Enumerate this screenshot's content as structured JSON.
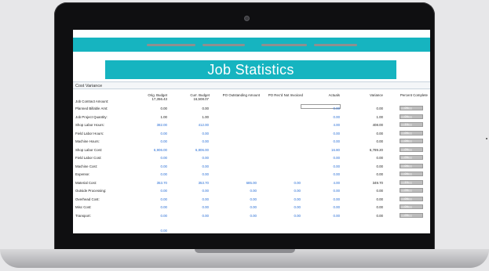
{
  "page": {
    "title": "Job Statistics",
    "section": "Cost Variance"
  },
  "columns": [
    "Orig. Budget",
    "Curr. Budget",
    "PO Outstanding Amount",
    "PO Rec'd Not Invoiced",
    "Actuals",
    "Variance",
    "Percent Complete"
  ],
  "header_values": {
    "label": "Job Contract Amount:",
    "orig": "17,356.43",
    "curr": "16,508.07"
  },
  "rows": [
    {
      "label": "Planned Billable Amt:",
      "orig": "0.00",
      "curr": "0.00",
      "actuals": "0.00",
      "variance": "0.00",
      "pct": "0%",
      "blue": false
    },
    {
      "label": "Job Project Quantity:",
      "orig": "1.00",
      "curr": "1.00",
      "actuals": "0.00",
      "variance": "1.00",
      "pct": "0%",
      "blue": false
    },
    {
      "label": "Shop Labor Hours:",
      "orig": "382.00",
      "curr": "412.00",
      "actuals": "4.00",
      "variance": "408.00",
      "pct": "1%",
      "blue": true
    },
    {
      "label": "Field Labor Hours:",
      "orig": "0.00",
      "curr": "0.00",
      "actuals": "0.00",
      "variance": "0.00",
      "pct": "0%",
      "blue": true
    },
    {
      "label": "Machine Hours:",
      "orig": "0.00",
      "curr": "0.00",
      "actuals": "0.00",
      "variance": "0.00",
      "pct": "0%",
      "blue": true
    },
    {
      "label": "Shop Labor Cost:",
      "orig": "6,906.00",
      "curr": "6,806.00",
      "actuals": "16.80",
      "variance": "6,789.20",
      "pct": "0%",
      "blue": true
    },
    {
      "label": "Field Labor Cost:",
      "orig": "0.00",
      "curr": "0.00",
      "actuals": "0.00",
      "variance": "0.00",
      "pct": "0%",
      "blue": true
    },
    {
      "label": "Machine Cost:",
      "orig": "0.00",
      "curr": "0.00",
      "actuals": "0.00",
      "variance": "0.00",
      "pct": "0%",
      "blue": true
    },
    {
      "label": "Expense:",
      "orig": "0.00",
      "curr": "0.00",
      "actuals": "0.00",
      "variance": "0.00",
      "pct": "0%",
      "blue": true
    },
    {
      "label": "Material Cost:",
      "orig": "353.70",
      "curr": "353.70",
      "po_out": "685.00",
      "po_rec": "0.00",
      "actuals": "4.00",
      "variance": "349.70",
      "pct": "1%",
      "blue": true
    },
    {
      "label": "Outside Processing:",
      "orig": "0.00",
      "curr": "0.00",
      "po_out": "0.00",
      "po_rec": "0.00",
      "actuals": "0.00",
      "variance": "0.00",
      "pct": "0%",
      "blue": true
    },
    {
      "label": "Overhead Cost:",
      "orig": "0.00",
      "curr": "0.00",
      "po_out": "0.00",
      "po_rec": "0.00",
      "actuals": "0.00",
      "variance": "0.00",
      "pct": "0%",
      "blue": true
    },
    {
      "label": "Misc Cost:",
      "orig": "0.00",
      "curr": "0.00",
      "po_out": "0.00",
      "po_rec": "0.00",
      "actuals": "0.00",
      "variance": "0.00",
      "pct": "0%",
      "blue": true
    },
    {
      "label": "Transport:",
      "orig": "0.00",
      "curr": "0.00",
      "po_out": "0.00",
      "po_rec": "0.00",
      "actuals": "0.00",
      "variance": "0.00",
      "pct": "0%",
      "blue": true
    }
  ],
  "colors": {
    "accent": "#16b4c0",
    "link_blue": "#2a6fd6"
  }
}
